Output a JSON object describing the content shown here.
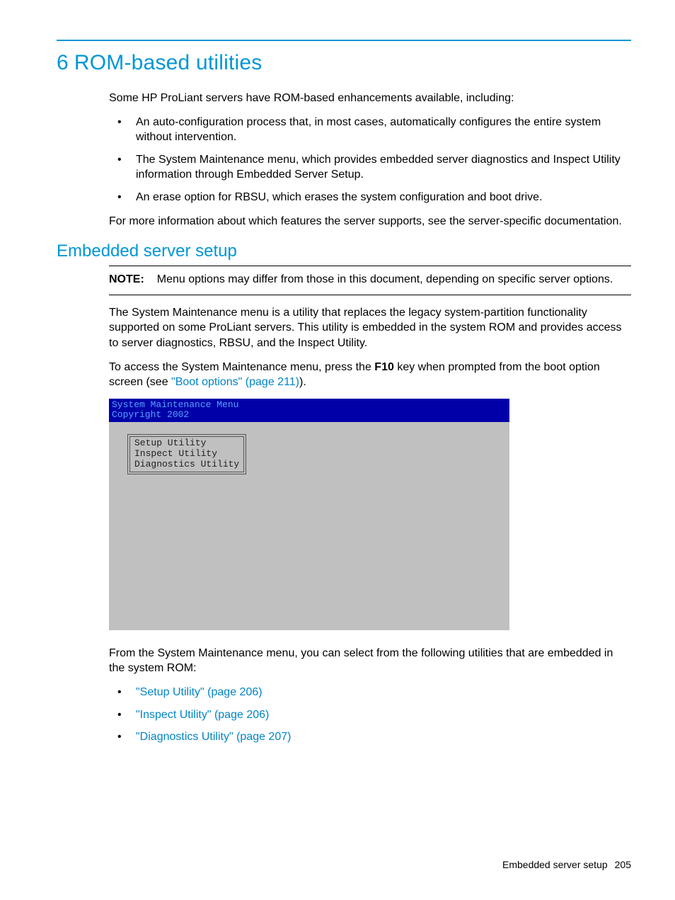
{
  "chapter": {
    "number": "6",
    "title": "ROM-based utilities"
  },
  "intro": "Some HP ProLiant servers have ROM-based enhancements available, including:",
  "intro_bullets": [
    "An auto-configuration process that, in most cases, automatically configures the entire system without intervention.",
    "The System Maintenance menu, which provides embedded server diagnostics and Inspect Utility information through Embedded Server Setup.",
    "An erase option for RBSU, which erases the system configuration and boot drive."
  ],
  "intro_after": "For more information about which features the server supports, see the server-specific documentation.",
  "section": {
    "title": "Embedded server setup",
    "note_label": "NOTE:",
    "note_text": "Menu options may differ from those in this document, depending on specific server options.",
    "para1": "The System Maintenance menu is a utility that replaces the legacy system-partition functionality supported on some ProLiant servers. This utility is embedded in the system ROM and provides access to server diagnostics, RBSU, and the Inspect Utility.",
    "para2_pre": "To access the System Maintenance menu, press the ",
    "para2_key": "F10",
    "para2_mid": " key when prompted from the boot option screen (see ",
    "para2_link": "\"Boot options\" (page 211)",
    "para2_post": ").",
    "screenshot": {
      "title_line1": "System Maintenance Menu",
      "title_line2": "Copyright 2002",
      "menu": [
        "Setup Utility",
        "Inspect Utility",
        "Diagnostics Utility"
      ]
    },
    "after_shot": "From the System Maintenance menu, you can select from the following utilities that are embedded in the system ROM:",
    "util_links": [
      "\"Setup Utility\" (page 206)",
      "\"Inspect Utility\" (page 206)",
      "\"Diagnostics Utility\" (page 207)"
    ]
  },
  "footer": {
    "text": "Embedded server setup",
    "page": "205"
  }
}
